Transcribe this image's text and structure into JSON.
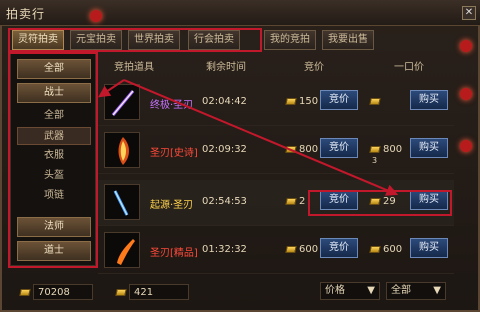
{
  "window": {
    "title": "拍卖行",
    "close_label": "✕"
  },
  "tabs": [
    {
      "label": "灵符拍卖"
    },
    {
      "label": "元宝拍卖"
    },
    {
      "label": "世界拍卖"
    },
    {
      "label": "行会拍卖"
    },
    {
      "label": "我的竞拍"
    },
    {
      "label": "我要出售"
    }
  ],
  "sidebar": {
    "items": [
      {
        "label": "全部",
        "type": "main"
      },
      {
        "label": "战士",
        "type": "main"
      },
      {
        "label": "全部",
        "type": "sub"
      },
      {
        "label": "武器",
        "type": "sub",
        "active": true
      },
      {
        "label": "衣服",
        "type": "sub"
      },
      {
        "label": "头盔",
        "type": "sub"
      },
      {
        "label": "项链",
        "type": "sub"
      },
      {
        "label": "法师",
        "type": "main"
      },
      {
        "label": "道士",
        "type": "main"
      }
    ]
  },
  "list": {
    "headers": {
      "item": "竞拍道具",
      "time": "剩余时间",
      "bid": "竞价",
      "buyout": "一口价"
    },
    "rows": [
      {
        "name": "终极·圣刃",
        "name_color": "#c874ff",
        "time": "02:04:42",
        "bid": "150",
        "bid_label": "竞价",
        "buyout": "",
        "buy_label": "购买"
      },
      {
        "name": "圣刃[史诗]",
        "name_color": "#ff4a3a",
        "time": "02:09:32",
        "bid": "800",
        "bid_label": "竞价",
        "buyout": "800",
        "buyout_sub": "3",
        "buy_label": "购买"
      },
      {
        "name": "起源·圣刃",
        "name_color": "#ffd24a",
        "time": "02:54:53",
        "bid": "2",
        "bid_label": "竞价",
        "buyout": "29",
        "buy_label": "购买"
      },
      {
        "name": "圣刃[精品]",
        "name_color": "#ff4a3a",
        "time": "01:32:32",
        "bid": "600",
        "bid_label": "竞价",
        "buyout": "600",
        "buy_label": "购买"
      }
    ]
  },
  "bottom": {
    "currency1": "70208",
    "currency2": "421",
    "sort_label": "价格",
    "filter_label": "全部"
  }
}
